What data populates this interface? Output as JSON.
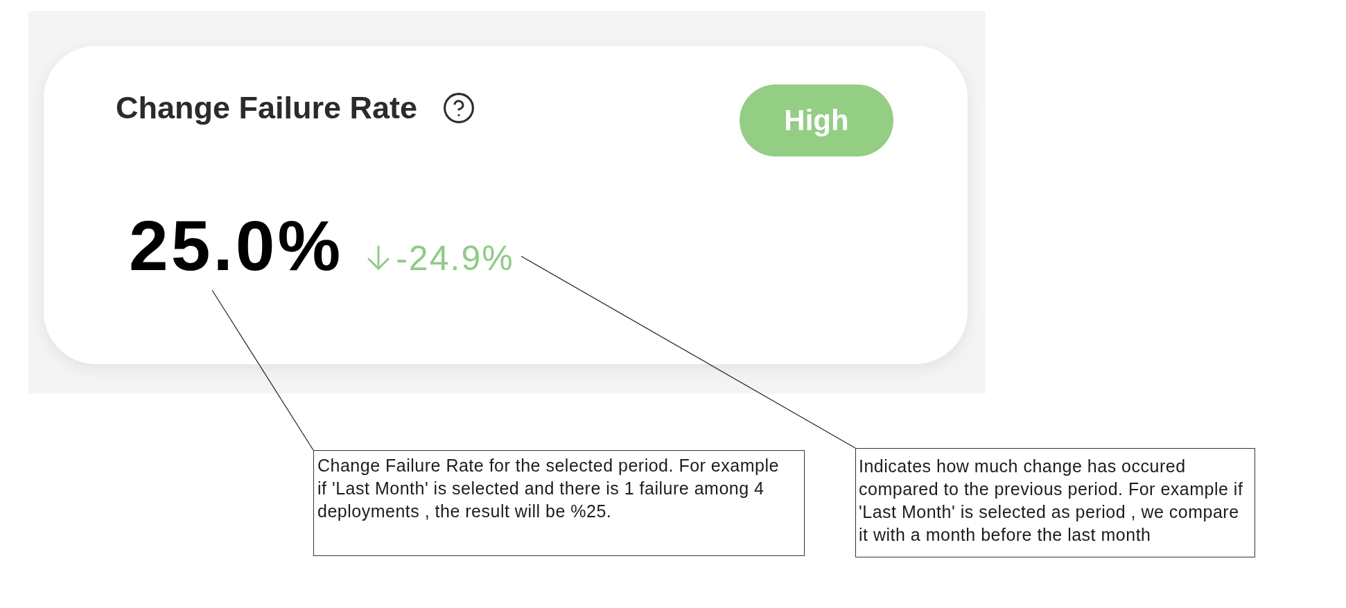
{
  "card": {
    "title": "Change Failure Rate",
    "badge": {
      "label": "High"
    },
    "value": "25.0%",
    "change": {
      "decrease": true,
      "text": "-24.9%"
    }
  },
  "annotations": [
    {
      "text": "Change Failure Rate for the selected period. For example\nif 'Last Month' is selected and there is 1 failure among 4\ndeployments , the result will be %25."
    },
    {
      "text": "Indicates how much change has occured\ncompared to the previous period. For example if\n'Last Month' is selected as period , we compare\nit with a month before the last month"
    }
  ]
}
